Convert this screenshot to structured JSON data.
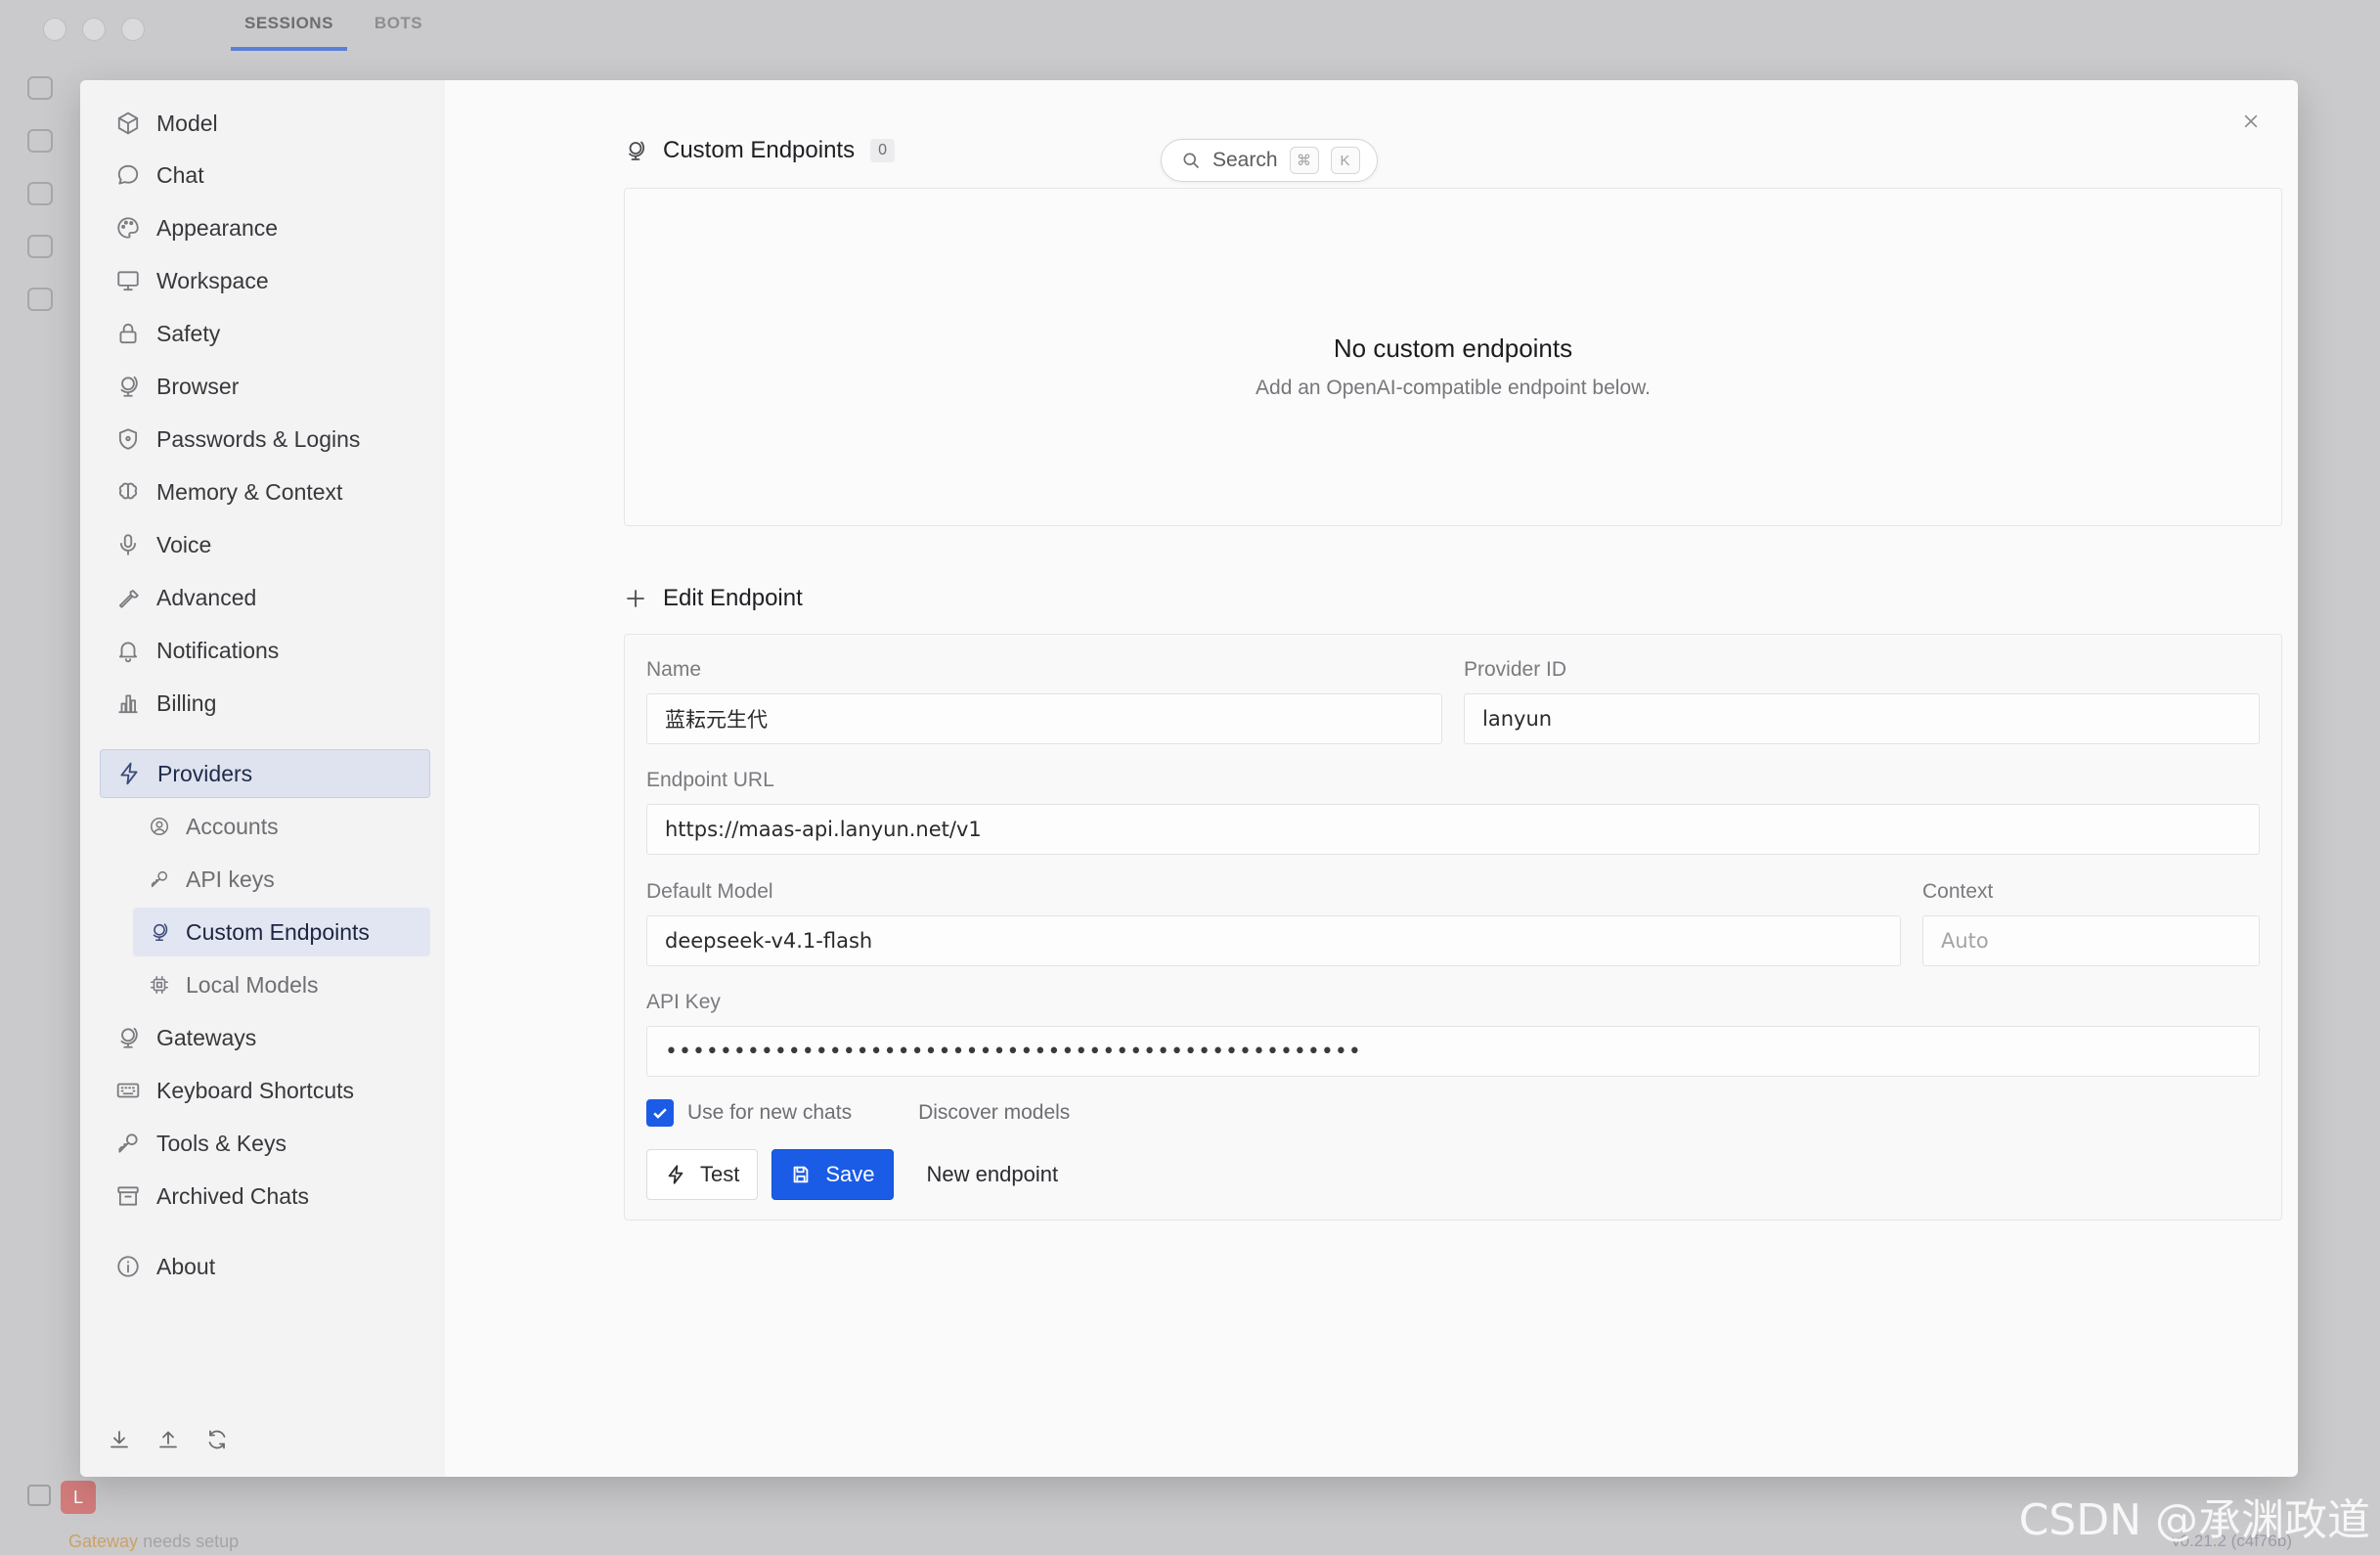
{
  "background": {
    "tabs": [
      "SESSIONS",
      "BOTS"
    ],
    "avatar_letter": "L",
    "status_prefix": "Gateway",
    "status_text": "needs setup",
    "version_text": "v0.21.2 (c4f76b)"
  },
  "search": {
    "label": "Search",
    "key_cmd": "⌘",
    "key_k": "K"
  },
  "sidebar": {
    "items": [
      {
        "label": "Model",
        "icon": "cube-icon"
      },
      {
        "label": "Chat",
        "icon": "chat-bubble-icon"
      },
      {
        "label": "Appearance",
        "icon": "palette-icon"
      },
      {
        "label": "Workspace",
        "icon": "monitor-icon"
      },
      {
        "label": "Safety",
        "icon": "lock-icon"
      },
      {
        "label": "Browser",
        "icon": "globe-stand-icon"
      },
      {
        "label": "Passwords & Logins",
        "icon": "shield-icon"
      },
      {
        "label": "Memory & Context",
        "icon": "brain-icon"
      },
      {
        "label": "Voice",
        "icon": "microphone-icon"
      },
      {
        "label": "Advanced",
        "icon": "wrench-icon"
      },
      {
        "label": "Notifications",
        "icon": "bell-icon"
      },
      {
        "label": "Billing",
        "icon": "bar-chart-icon"
      }
    ],
    "providers": {
      "label": "Providers",
      "sub": [
        {
          "label": "Accounts",
          "icon": "user-circle-icon"
        },
        {
          "label": "API keys",
          "icon": "key-icon"
        },
        {
          "label": "Custom Endpoints",
          "icon": "globe-stand-icon"
        },
        {
          "label": "Local Models",
          "icon": "chip-icon"
        }
      ]
    },
    "items_after": [
      {
        "label": "Gateways",
        "icon": "globe-stand-icon"
      },
      {
        "label": "Keyboard Shortcuts",
        "icon": "keyboard-icon"
      },
      {
        "label": "Tools & Keys",
        "icon": "key-icon"
      },
      {
        "label": "Archived Chats",
        "icon": "archive-icon"
      }
    ],
    "about": "About"
  },
  "custom_endpoints": {
    "title": "Custom Endpoints",
    "count": "0",
    "empty_title": "No custom endpoints",
    "empty_subtitle": "Add an OpenAI-compatible endpoint below."
  },
  "edit_endpoint": {
    "title": "Edit Endpoint",
    "name_label": "Name",
    "name_value": "蓝耘元生代",
    "provider_id_label": "Provider ID",
    "provider_id_value": "lanyun",
    "endpoint_url_label": "Endpoint URL",
    "endpoint_url_value": "https://maas-api.lanyun.net/v1",
    "default_model_label": "Default Model",
    "default_model_value": "deepseek-v4.1-flash",
    "context_label": "Context",
    "context_placeholder": "Auto",
    "api_key_label": "API Key",
    "api_key_value": "•••••••••••••••••••••••••••••••••••••••••••••••••••",
    "use_for_new_chats": {
      "label": "Use for new chats",
      "checked": true
    },
    "discover_models": {
      "label": "Discover models",
      "checked": false
    },
    "test_button": "Test",
    "save_button": "Save",
    "new_endpoint_button": "New endpoint"
  },
  "colors": {
    "accent": "#1a5ce6",
    "active_nav_bg": "#dfe3ef"
  },
  "watermark": "CSDN @承渊政道"
}
